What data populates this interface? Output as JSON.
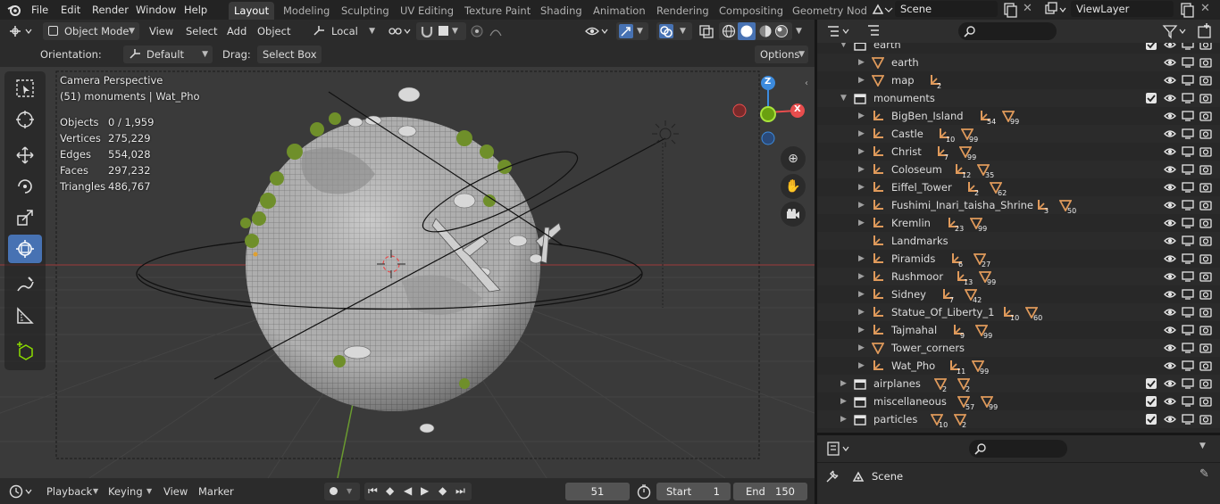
{
  "topbar": {
    "menus": [
      "File",
      "Edit",
      "Render",
      "Window",
      "Help"
    ],
    "workspaces": [
      "Layout",
      "Modeling",
      "Sculpting",
      "UV Editing",
      "Texture Paint",
      "Shading",
      "Animation",
      "Rendering",
      "Compositing",
      "Geometry Nod"
    ],
    "active_workspace": "Layout",
    "scene": "Scene",
    "view_layer": "ViewLayer"
  },
  "viewport_header": {
    "mode": "Object Mode",
    "menus": [
      "View",
      "Select",
      "Add",
      "Object"
    ],
    "transform_orientation": "Local"
  },
  "tool_settings": {
    "orientation_label": "Orientation:",
    "orientation_value": "Default",
    "drag_label": "Drag:",
    "drag_value": "Select Box",
    "options_label": "Options"
  },
  "overlay": {
    "view_name": "Camera Perspective",
    "context": "(51) monuments | Wat_Pho",
    "stats": [
      {
        "label": "Objects",
        "value": "0 / 1,959"
      },
      {
        "label": "Vertices",
        "value": "275,229"
      },
      {
        "label": "Edges",
        "value": "554,028"
      },
      {
        "label": "Faces",
        "value": "297,232"
      },
      {
        "label": "Triangles",
        "value": "486,767"
      }
    ]
  },
  "gizmo_axes": {
    "z": "Z",
    "x": "X"
  },
  "timeline": {
    "menus": [
      "Playback",
      "Keying",
      "View",
      "Marker"
    ],
    "current_frame": "51",
    "start_label": "Start",
    "start_value": "1",
    "end_label": "End",
    "end_value": "150"
  },
  "outliner": {
    "rows": [
      {
        "label": "earth",
        "type": "collection",
        "depth": 1,
        "expanded": true,
        "badges": []
      },
      {
        "label": "earth",
        "type": "mesh",
        "depth": 2,
        "badges": []
      },
      {
        "label": "map",
        "type": "mesh",
        "depth": 2,
        "badges": [
          "2"
        ]
      },
      {
        "label": "monuments",
        "type": "collection",
        "depth": 1,
        "expanded": true,
        "badges": []
      },
      {
        "label": "BigBen_Island",
        "type": "empty",
        "depth": 2,
        "badges": [
          "54",
          "99"
        ]
      },
      {
        "label": "Castle",
        "type": "empty",
        "depth": 2,
        "badges": [
          "10",
          "99"
        ]
      },
      {
        "label": "Christ",
        "type": "empty",
        "depth": 2,
        "badges": [
          "7",
          "99"
        ]
      },
      {
        "label": "Coloseum",
        "type": "empty",
        "depth": 2,
        "badges": [
          "12",
          "35"
        ]
      },
      {
        "label": "Eiffel_Tower",
        "type": "empty",
        "depth": 2,
        "badges": [
          "2",
          "62"
        ]
      },
      {
        "label": "Fushimi_Inari_taisha_Shrine",
        "type": "empty",
        "depth": 2,
        "badges": [
          "3",
          "50"
        ]
      },
      {
        "label": "Kremlin",
        "type": "empty",
        "depth": 2,
        "badges": [
          "23",
          "99"
        ]
      },
      {
        "label": "Landmarks",
        "type": "empty",
        "depth": 2,
        "badges": []
      },
      {
        "label": "Piramids",
        "type": "empty",
        "depth": 2,
        "badges": [
          "6",
          "27"
        ]
      },
      {
        "label": "Rushmoor",
        "type": "empty",
        "depth": 2,
        "badges": [
          "13",
          "99"
        ]
      },
      {
        "label": "Sidney",
        "type": "empty",
        "depth": 2,
        "badges": [
          "7",
          "42"
        ]
      },
      {
        "label": "Statue_Of_Liberty_1",
        "type": "empty",
        "depth": 2,
        "badges": [
          "10",
          "60"
        ]
      },
      {
        "label": "Tajmahal",
        "type": "empty",
        "depth": 2,
        "badges": [
          "9",
          "99"
        ]
      },
      {
        "label": "Tower_corners",
        "type": "mesh",
        "depth": 2,
        "badges": []
      },
      {
        "label": "Wat_Pho",
        "type": "empty",
        "depth": 2,
        "badges": [
          "11",
          "99"
        ]
      },
      {
        "label": "airplanes",
        "type": "collection",
        "depth": 1,
        "badges": [
          "2",
          "2"
        ]
      },
      {
        "label": "miscellaneous",
        "type": "collection",
        "depth": 1,
        "badges": [
          "57",
          "99"
        ]
      },
      {
        "label": "particles",
        "type": "collection",
        "depth": 1,
        "badges": [
          "10",
          "2"
        ]
      }
    ]
  },
  "properties": {
    "context": "Scene"
  },
  "colors": {
    "accent": "#4772b3",
    "object_orange": "#e09a5b",
    "collection_white": "#e6e6e6",
    "axis_x": "#e84d4d",
    "axis_y": "#8bdc00",
    "axis_z": "#3c8bde"
  }
}
